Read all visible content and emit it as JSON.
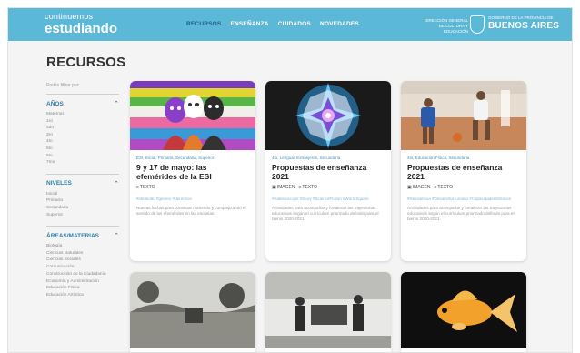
{
  "header": {
    "logo_top": "continuemos",
    "logo_bottom": "estudiando",
    "nav": [
      "RECURSOS",
      "ENSEÑANZA",
      "CUIDADOS",
      "NOVEDADES"
    ],
    "gov_text": "DIRECCIÓN GENERAL DE CULTURA Y EDUCACIÓN",
    "ba_top": "GOBIERNO DE LA PROVINCIA DE",
    "ba_bottom": "BUENOS AIRES"
  },
  "page": {
    "title": "RECURSOS"
  },
  "sidebar": {
    "filter_by": "Podés filtrar por:",
    "sections": [
      {
        "title": "AÑOS",
        "options": [
          "Maternal",
          "1ro",
          "2do",
          "3ro",
          "4to",
          "5to",
          "6to",
          "7mo"
        ]
      },
      {
        "title": "NIVELES",
        "options": [
          "Inicial",
          "Primaria",
          "Secundaria",
          "Superior"
        ]
      },
      {
        "title": "ÁREAS/MATERIAS",
        "options": [
          "Biología",
          "Ciencias Naturales",
          "Ciencias Sociales",
          "Comunicación",
          "Construcción de la Ciudadanía",
          "Economía y Administración",
          "Educación Física",
          "Educación Artística"
        ]
      }
    ]
  },
  "cards": [
    {
      "tags": "ESI, Inicial, Primaria, Secundaria, Superior",
      "title": "9 y 17 de mayo: las efemérides de la ESI",
      "types": [
        "TEXTO"
      ],
      "hashtags": "#identidad #género #derechos",
      "desc": "Nuevas fechas para continuar nutriendo y complejizando el sentido de las efemérides en las escuelas."
    },
    {
      "tags": "4to, Lenguas Extranjeras, Secundaria",
      "title": "Propuestas de enseñanza 2021",
      "types": [
        "IMAGEN",
        "TEXTO"
      ],
      "hashtags": "#Kaleidoscope #Story #ScienceFiction #WorldSquare",
      "desc": "Actividades para acompañar y fortalecer las trayectorias educativas según el currículum priorizado definido para el bienio 2020-2021."
    },
    {
      "tags": "4to, Educación Física, Secundaria",
      "title": "Propuestas de enseñanza 2021",
      "types": [
        "IMAGEN",
        "TEXTO"
      ],
      "hashtags": "#Resistencia #DesarrolloHumano #CapacidadesMotrices",
      "desc": "Actividades para acompañar y fortalecer las trayectorias educativas según el currículum priorizado definido para el bienio 2020-2021."
    }
  ],
  "colors": {
    "topbar": "#5bb8d6",
    "nav_active": "#1d5f83",
    "section_title": "#2f7fa9",
    "tag": "#3d93bf"
  },
  "icons": {
    "collapse": "chevron-up-icon",
    "text_type": "text-icon",
    "image_type": "image-icon"
  }
}
